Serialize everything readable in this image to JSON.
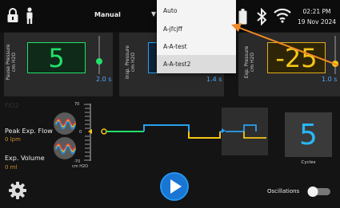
{
  "status_bar": {
    "mode_label": "Manual",
    "time": "02:21 PM",
    "date": "19 Nov 2024",
    "icons": [
      "lock-icon",
      "person-icon",
      "dropdown-caret-icon",
      "battery-icon",
      "bluetooth-icon",
      "wifi-icon"
    ]
  },
  "mode_dropdown": {
    "options": [
      "Auto",
      "A-jfcjff",
      "A-A-test",
      "A-A-test2"
    ],
    "selected": "A-A-test2"
  },
  "pause_pressure": {
    "label": "Pause Pressure",
    "unit": "cm H2O",
    "value": "5",
    "seconds": "2.0 s",
    "color": "#22e06a"
  },
  "insp_pressure": {
    "label": "Insp. Pressure",
    "unit": "cm H2O",
    "seconds": "1.4 s",
    "color": "#29a0f0"
  },
  "exp_pressure": {
    "label": "Exp. Pressure",
    "unit": "cm H2O",
    "value": "-25",
    "seconds": "1.0 s",
    "color": "#e0b020"
  },
  "waveform": {
    "fio2_label": "FiO2",
    "peak_exp_flow_label": "Peak Exp. Flow",
    "peak_exp_flow_value": "0 lpm",
    "exp_volume_label": "Exp. Volume",
    "exp_volume_value": "0 ml",
    "axis_max": "70",
    "axis_zero": "0",
    "axis_min": "-70",
    "axis_unit": "cm H2O"
  },
  "cycles": {
    "value": "5",
    "label": "Cycles"
  },
  "oscillations": {
    "label": "Oscillations",
    "enabled": false
  },
  "colors": {
    "accent_blue": "#29b6f6",
    "insp_blue": "#1e88e5",
    "exp_yellow": "#f5c518",
    "pause_green": "#22e06a",
    "callout_orange": "#f08a24"
  }
}
